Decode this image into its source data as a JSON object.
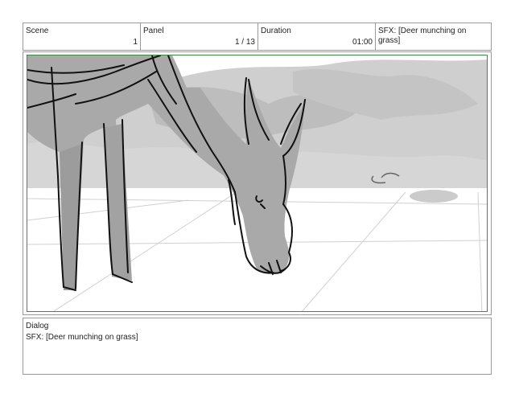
{
  "header": {
    "scene_label": "Scene",
    "scene_value": "1",
    "panel_label": "Panel",
    "panel_value": "1 / 13",
    "duration_label": "Duration",
    "duration_value": "01:00",
    "sfx_text": "SFX: [Deer munching on grass]"
  },
  "dialog": {
    "title": "Dialog",
    "text": "SFX: [Deer munching on grass]"
  },
  "colors": {
    "frame_border": "#3e8a3e",
    "deer_fill": "#a6a6a6",
    "background_haze": "#c7c7c7"
  }
}
